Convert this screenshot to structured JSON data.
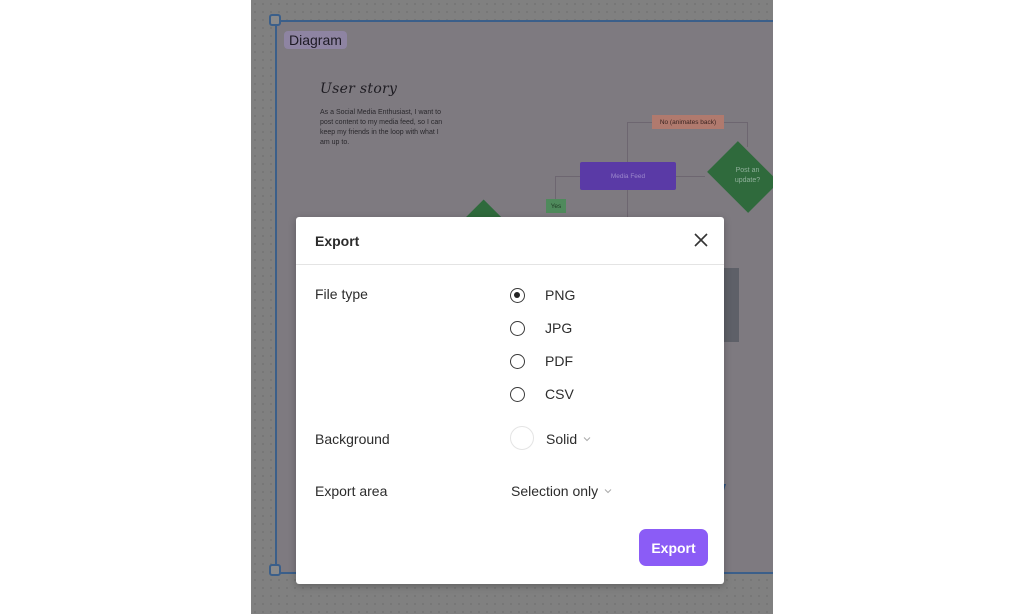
{
  "canvas": {
    "frame_label": "Diagram",
    "user_story": {
      "title": "User story",
      "text": "As a Social Media Enthusiast, I want to post content to my media feed, so I can keep my friends in the loop with what I am up to."
    },
    "flowchart": {
      "media_feed": "Media Feed",
      "no_label": "No (animates back)",
      "yes_label": "Yes",
      "decision": "Post an update?"
    }
  },
  "dialog": {
    "title": "Export",
    "file_type": {
      "label": "File type",
      "options": [
        {
          "label": "PNG",
          "checked": true
        },
        {
          "label": "JPG",
          "checked": false
        },
        {
          "label": "PDF",
          "checked": false
        },
        {
          "label": "CSV",
          "checked": false
        }
      ]
    },
    "background": {
      "label": "Background",
      "swatch_color": "#ffffff",
      "value": "Solid"
    },
    "export_area": {
      "label": "Export area",
      "value": "Selection only"
    },
    "export_button": "Export"
  },
  "colors": {
    "accent": "#8b5cf6",
    "frame_border": "#3b5f8a"
  }
}
